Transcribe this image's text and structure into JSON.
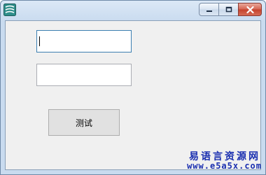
{
  "window": {
    "icon": "app-icon",
    "buttons": {
      "minimize": "minimize-icon",
      "maximize": "maximize-icon",
      "close": "close-icon"
    }
  },
  "form": {
    "input1": {
      "value": ""
    },
    "input2": {
      "value": ""
    },
    "test_button": "测试"
  },
  "watermark": {
    "title": "易语言资源网",
    "url": "www.e5a5x.com",
    "color": "#1a2fb0"
  }
}
